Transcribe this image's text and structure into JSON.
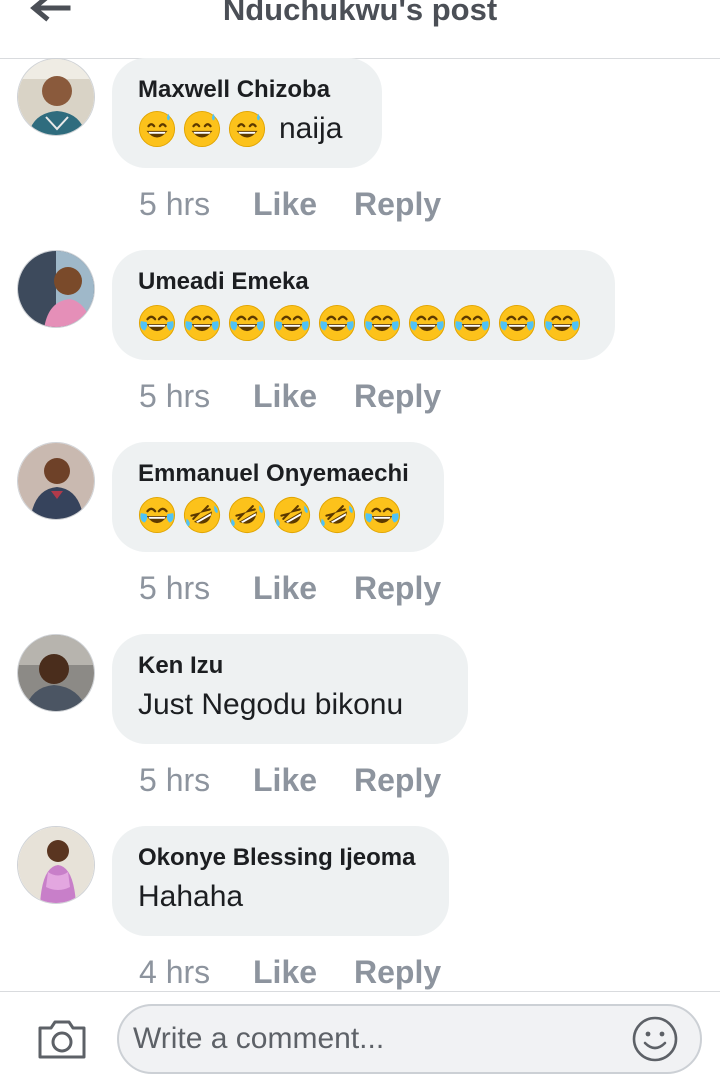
{
  "header": {
    "title": "Nduchukwu's post",
    "back_icon": "arrow-left-icon"
  },
  "comments": [
    {
      "author": "Maxwell Chizoba",
      "emojis": [
        "grinning-sweat",
        "grinning-sweat",
        "grinning-sweat"
      ],
      "text": "naija",
      "time": "5 hrs",
      "like": "Like",
      "reply": "Reply"
    },
    {
      "author": "Umeadi Emeka",
      "emojis": [
        "tears-of-joy",
        "tears-of-joy",
        "tears-of-joy",
        "tears-of-joy",
        "tears-of-joy",
        "tears-of-joy",
        "tears-of-joy",
        "tears-of-joy",
        "tears-of-joy",
        "tears-of-joy"
      ],
      "text": "",
      "time": "5 hrs",
      "like": "Like",
      "reply": "Reply"
    },
    {
      "author": "Emmanuel Onyemaechi",
      "emojis": [
        "tears-of-joy",
        "rolling-laughing",
        "rolling-laughing",
        "rolling-laughing",
        "rolling-laughing",
        "tears-of-joy"
      ],
      "text": "",
      "time": "5 hrs",
      "like": "Like",
      "reply": "Reply"
    },
    {
      "author": "Ken Izu",
      "emojis": [],
      "text": "Just Negodu bikonu",
      "time": "5 hrs",
      "like": "Like",
      "reply": "Reply"
    },
    {
      "author": "Okonye Blessing Ijeoma",
      "emojis": [],
      "text": "Hahaha",
      "time": "4 hrs",
      "like": "Like",
      "reply": "Reply"
    }
  ],
  "composer": {
    "placeholder": "Write a comment...",
    "camera_icon": "camera-icon",
    "emoji_icon": "smiley-icon"
  },
  "colors": {
    "meta_gray": "#8d949e",
    "bubble_bg": "#eef1f2",
    "text": "#1c1e21",
    "header_text": "#4b4f56",
    "emoji_yellow": "#fcc21b",
    "tear_blue": "#4fc3f7"
  }
}
